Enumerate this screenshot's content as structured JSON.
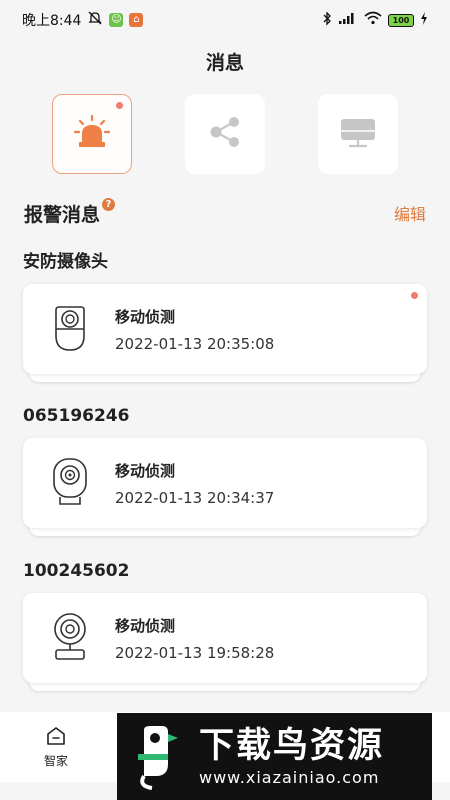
{
  "status_bar": {
    "time": "晚上8:44",
    "battery": "100"
  },
  "page": {
    "title": "消息"
  },
  "categories": [
    {
      "name": "alarm-icon",
      "active": true,
      "unread": true
    },
    {
      "name": "share-icon",
      "active": false,
      "unread": false
    },
    {
      "name": "monitor-icon",
      "active": false,
      "unread": false
    }
  ],
  "section": {
    "title": "报警消息",
    "help": "?",
    "edit_label": "编辑"
  },
  "groups": [
    {
      "title": "安防摄像头",
      "event": "移动侦测",
      "time": "2022-01-13 20:35:08",
      "unread": true
    },
    {
      "title": "065196246",
      "event": "移动侦测",
      "time": "2022-01-13 20:34:37",
      "unread": false
    },
    {
      "title": "100245602",
      "event": "移动侦测",
      "time": "2022-01-13 19:58:28",
      "unread": false
    }
  ],
  "tab_bar": {
    "home_label": "智家"
  },
  "watermark": {
    "title": "下载鸟资源",
    "url": "www.xiazainiao.com"
  },
  "colors": {
    "accent": "#e07a3e",
    "unread_dot": "#f07b6e",
    "background": "#f5f5f5"
  }
}
